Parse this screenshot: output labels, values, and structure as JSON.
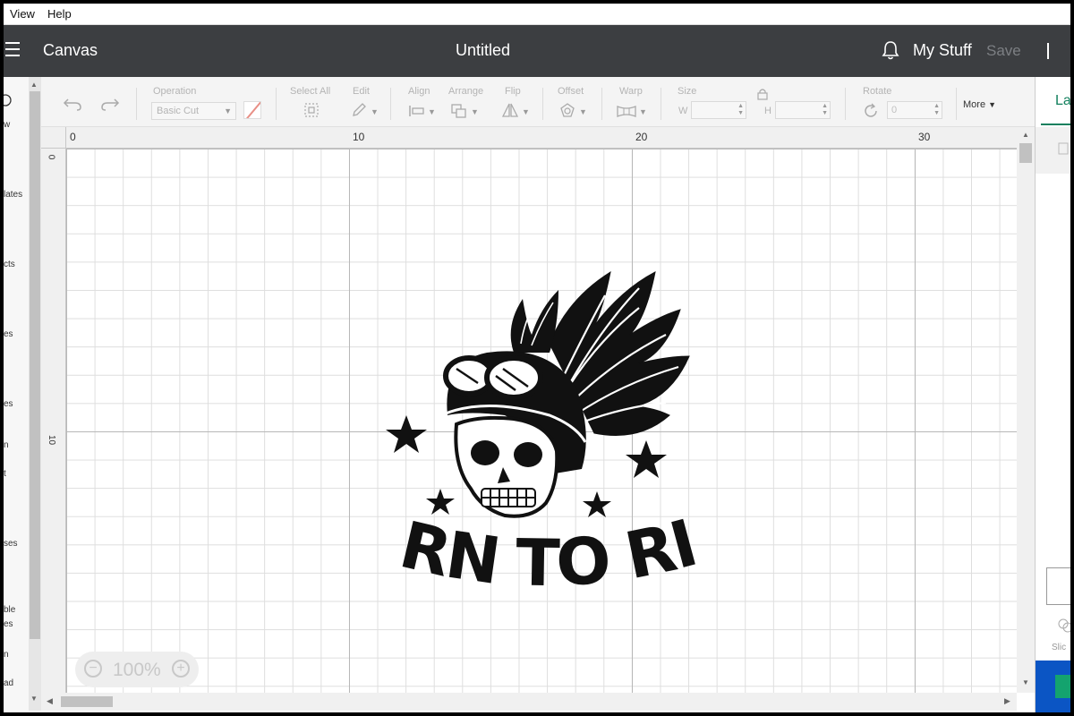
{
  "menu": {
    "items": [
      "View",
      "Help"
    ]
  },
  "header": {
    "app_name": "Canvas",
    "doc_title": "Untitled",
    "my_stuff": "My Stuff",
    "save": "Save"
  },
  "toolbar": {
    "operation_label": "Operation",
    "operation_value": "Basic Cut",
    "select_all": "Select All",
    "edit": "Edit",
    "align": "Align",
    "arrange": "Arrange",
    "flip": "Flip",
    "offset": "Offset",
    "warp": "Warp",
    "size": "Size",
    "size_w": "W",
    "size_h": "H",
    "rotate": "Rotate",
    "rotate_value": "0",
    "more": "More"
  },
  "left_sidebar": {
    "items": [
      "w",
      "lates",
      "cts",
      "es",
      "es",
      "n",
      "t",
      "ses",
      "ble",
      "es",
      "n",
      "ad"
    ]
  },
  "rulers": {
    "top": [
      "0",
      "10",
      "20",
      "30"
    ],
    "left": [
      "0",
      "10"
    ]
  },
  "design": {
    "text": "BORN TO RIDE",
    "icon_name": "winged-skull-helmet"
  },
  "zoom": {
    "value": "100%"
  },
  "right_panel": {
    "tab": "La",
    "slice": "Slic"
  },
  "colors": {
    "header_bg": "#3c3e41",
    "accent_green": "#14805e",
    "blue": "#0b55c4"
  }
}
